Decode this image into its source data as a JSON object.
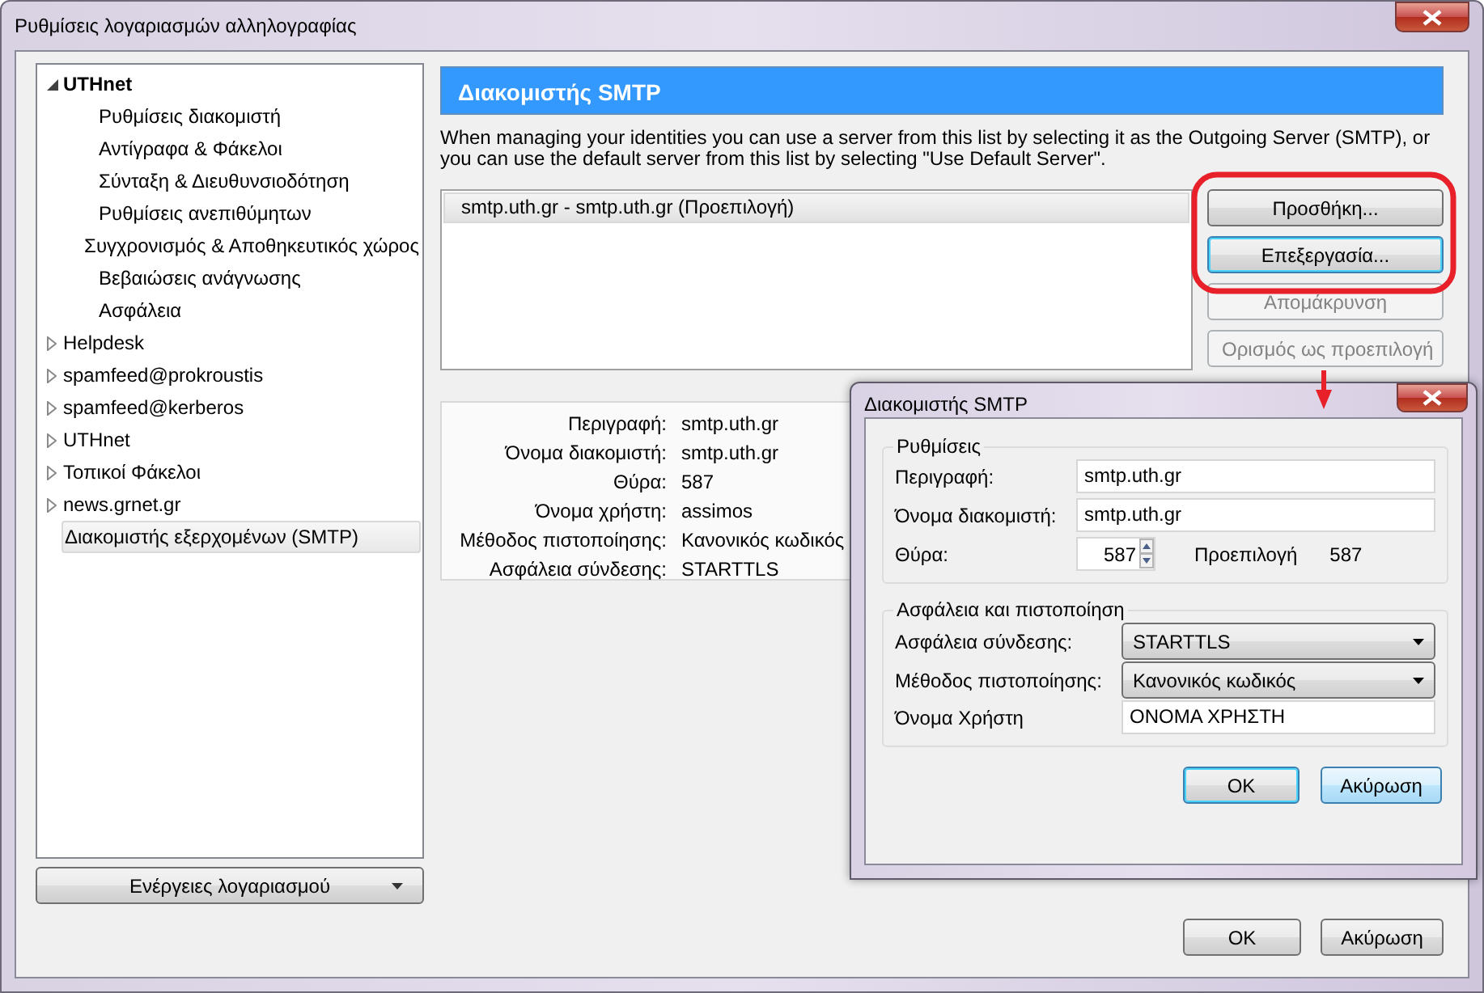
{
  "window": {
    "title": "Ρυθμίσεις λογαριασμών αλληλογραφίας"
  },
  "sidebar": {
    "items": [
      {
        "label": "UTHnet",
        "expanded": true,
        "selected": false,
        "children": [
          {
            "label": "Ρυθμίσεις διακομιστή",
            "selected": false
          },
          {
            "label": "Αντίγραφα & Φάκελοι",
            "selected": false
          },
          {
            "label": "Σύνταξη & Διευθυνσιοδότηση",
            "selected": false
          },
          {
            "label": "Ρυθμίσεις ανεπιθύμητων",
            "selected": false
          },
          {
            "label": "Συγχρονισμός & Αποθηκευτικός χώρος",
            "selected": false
          },
          {
            "label": "Βεβαιώσεις ανάγνωσης",
            "selected": false
          },
          {
            "label": "Ασφάλεια",
            "selected": false
          }
        ]
      },
      {
        "label": "Helpdesk",
        "expanded": false,
        "selected": false
      },
      {
        "label": "spamfeed@prokroustis",
        "expanded": false,
        "selected": false
      },
      {
        "label": "spamfeed@kerberos",
        "expanded": false,
        "selected": false
      },
      {
        "label": "UTHnet",
        "expanded": false,
        "selected": false
      },
      {
        "label": "Τοπικοί Φάκελοι",
        "expanded": false,
        "selected": false
      },
      {
        "label": "news.grnet.gr",
        "expanded": false,
        "selected": false
      },
      {
        "label": "Διακομιστής εξερχομένων (SMTP)",
        "selected": true
      }
    ]
  },
  "account_actions": {
    "label": "Ενέργειες λογαριασμού"
  },
  "panel": {
    "title": "Διακομιστής SMTP",
    "description": "When managing your identities you can use a server from this list by selecting it as the Outgoing Server (SMTP), or you can use the default server from this list by selecting \"Use Default Server\".",
    "servers": [
      {
        "label": "smtp.uth.gr - smtp.uth.gr (Προεπιλογή)",
        "selected": true
      }
    ],
    "buttons": [
      {
        "label": "Προσθήκη...",
        "disabled": false,
        "focused": false
      },
      {
        "label": "Επεξεργασία...",
        "disabled": false,
        "focused": true
      },
      {
        "label": "Απομάκρυνση",
        "disabled": true,
        "focused": false
      },
      {
        "label": "Ορισμός ως προεπιλογή",
        "disabled": true,
        "focused": false
      }
    ],
    "details": [
      {
        "label": "Περιγραφή:",
        "value": "smtp.uth.gr"
      },
      {
        "label": "Όνομα διακομιστή:",
        "value": "smtp.uth.gr"
      },
      {
        "label": "Θύρα:",
        "value": "587"
      },
      {
        "label": "Όνομα χρήστη:",
        "value": "assimos"
      },
      {
        "label": "Μέθοδος πιστοποίησης:",
        "value": "Κανονικός κωδικός"
      },
      {
        "label": "Ασφάλεια σύνδεσης:",
        "value": "STARTTLS"
      }
    ]
  },
  "footer_buttons": [
    {
      "label": "OK"
    },
    {
      "label": "Ακύρωση"
    }
  ],
  "dialog": {
    "title": "Διακομιστής SMTP",
    "groups": [
      {
        "title": "Ρυθμίσεις",
        "rows": [
          {
            "kind": "text",
            "label": "Περιγραφή:",
            "value": "smtp.uth.gr"
          },
          {
            "kind": "text",
            "label": "Όνομα διακομιστή:",
            "value": "smtp.uth.gr"
          },
          {
            "kind": "spin",
            "label": "Θύρα:",
            "value": "587",
            "default_label": "Προεπιλογή",
            "default_value": "587"
          }
        ]
      },
      {
        "title": "Ασφάλεια και πιστοποίηση",
        "rows": [
          {
            "kind": "select",
            "label": "Ασφάλεια σύνδεσης:",
            "value": "STARTTLS"
          },
          {
            "kind": "select",
            "label": "Μέθοδος πιστοποίησης:",
            "value": "Κανονικός κωδικός"
          },
          {
            "kind": "text",
            "label": "Όνομα Χρήστη",
            "value": "ΟΝΟΜΑ ΧΡΗΣΤΗ"
          }
        ]
      }
    ],
    "buttons": [
      {
        "label": "OK",
        "focused": true,
        "hovered": false
      },
      {
        "label": "Ακύρωση",
        "focused": false,
        "hovered": true
      }
    ]
  }
}
